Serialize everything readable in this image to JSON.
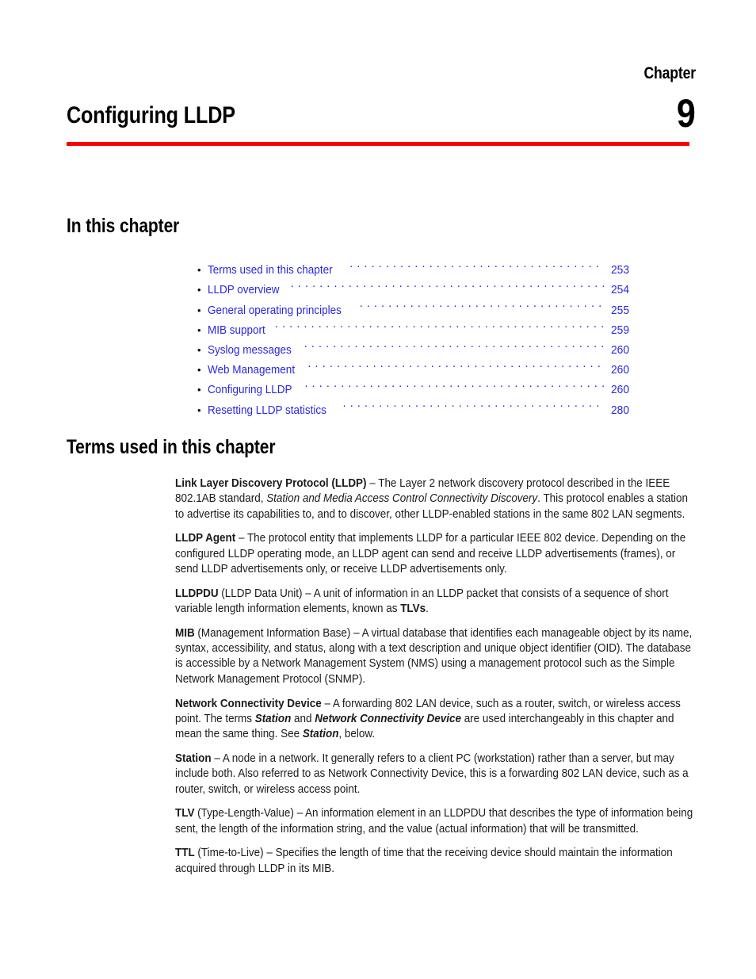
{
  "chapter": {
    "label": "Chapter",
    "number": "9",
    "title": "Configuring LLDP",
    "rule_color": "#fa0000"
  },
  "link_color": "#2a26e0",
  "sections": {
    "in_this_chapter_heading": "In this chapter",
    "terms_heading": "Terms used in this chapter"
  },
  "toc": {
    "bullet": "•",
    "items": [
      {
        "label": "Terms used in this chapter",
        "page": "253"
      },
      {
        "label": "LLDP overview",
        "page": "254"
      },
      {
        "label": "General operating principles",
        "page": "255"
      },
      {
        "label": "MIB support",
        "page": "259"
      },
      {
        "label": "Syslog messages",
        "page": "260"
      },
      {
        "label": "Web Management",
        "page": "260"
      },
      {
        "label": "Configuring LLDP",
        "page": "260"
      },
      {
        "label": "Resetting LLDP statistics",
        "page": "280"
      }
    ]
  },
  "terms": [
    {
      "id": "lldp",
      "term": "Link Layer Discovery Protocol (LLDP)",
      "text_1": " – The Layer 2 network discovery protocol described in the IEEE 802.1AB standard, ",
      "italic_1": "Station and Media Access Control Connectivity Discovery",
      "text_2": ".  This protocol enables a station to advertise its capabilities to, and to discover, other LLDP-enabled stations in the same 802 LAN segments."
    },
    {
      "id": "lldp-agent",
      "term": "LLDP Agent",
      "text_1": " – The protocol entity that implements LLDP for a particular IEEE 802 device. Depending on the configured LLDP operating mode, an LLDP agent can send and receive LLDP advertisements (frames), or send LLDP advertisements only, or receive LLDP advertisements only."
    },
    {
      "id": "lldpdu",
      "term": "LLDPDU",
      "text_1": " (LLDP Data Unit) – A unit of information in an LLDP packet that consists of a sequence of short variable length information elements, known as ",
      "bold_1": "TLVs",
      "text_2": "."
    },
    {
      "id": "mib",
      "term": "MIB",
      "text_1": " (Management Information Base) – A virtual database that identifies each manageable object by its name, syntax, accessibility, and status, along with a text description and unique object identifier (OID).  The database is  accessible by a Network Management System (NMS) using a management protocol such as the Simple Network Management Protocol (SNMP)."
    },
    {
      "id": "network-connectivity-device",
      "term": "Network Connectivity Device",
      "text_1": " – A forwarding 802 LAN device, such as a router, switch, or wireless access point.  The terms ",
      "bolditalic_1": "Station",
      "text_2": " and ",
      "bolditalic_2": "Network Connectivity Device",
      "text_3": " are used interchangeably in this chapter and mean the same thing.  See ",
      "bolditalic_3": "Station",
      "text_4": ", below."
    },
    {
      "id": "station",
      "term": "Station",
      "text_1": " – A node in a network.  It generally refers to a client PC (workstation) rather than a server, but may include both.  Also referred to as Network Connectivity Device, this is a forwarding 802 LAN device, such as a router, switch, or wireless access point."
    },
    {
      "id": "tlv",
      "term": "TLV",
      "text_1": " (Type-Length-Value) – An information element in an LLDPDU that describes the type of information being sent, the length of the information string, and the value (actual information) that will be transmitted."
    },
    {
      "id": "ttl",
      "term": "TTL",
      "text_1": " (Time-to-Live) – Specifies the length of time that the receiving device should maintain the information acquired through LLDP in its MIB."
    }
  ]
}
